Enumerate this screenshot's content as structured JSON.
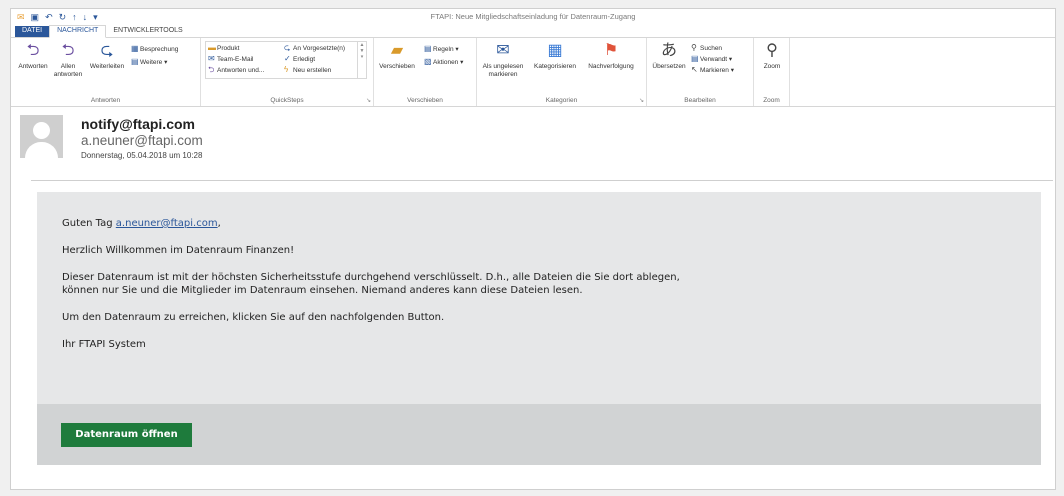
{
  "window": {
    "title": "FTAPI: Neue Mitgliedschaftseinladung für Datenraum-Zugang",
    "qat_icons": [
      "mail-icon",
      "save-icon",
      "undo-icon",
      "redo-icon",
      "up-arrow-icon",
      "down-arrow-icon",
      "customize-icon"
    ]
  },
  "tabs": [
    "DATEI",
    "NACHRICHT",
    "ENTWICKLERTOOLS"
  ],
  "ribbon": {
    "antworten": {
      "label": "Antworten",
      "reply": "Antworten",
      "reply_all": "Allen antworten",
      "forward": "Weiterleiten",
      "meeting": "Besprechung",
      "more": "Weitere"
    },
    "quicksteps": {
      "label": "QuickSteps",
      "items": [
        "Produkt",
        "Team-E-Mail",
        "Antworten und...",
        "An Vorgesetzte(n)",
        "Erledigt",
        "Neu erstellen"
      ]
    },
    "verschieben": {
      "label": "Verschieben",
      "move": "Verschieben",
      "rules": "Regeln",
      "actions": "Aktionen"
    },
    "kategorien": {
      "label": "Kategorien",
      "unread": "Als ungelesen markieren",
      "categorize": "Kategorisieren",
      "followup": "Nachverfolgung"
    },
    "bearbeiten": {
      "label": "Bearbeiten",
      "translate": "Übersetzen",
      "search": "Suchen",
      "related": "Verwandt",
      "select": "Markieren"
    },
    "zoom": {
      "label": "Zoom",
      "zoom": "Zoom"
    }
  },
  "message": {
    "from": "notify@ftapi.com",
    "to": "a.neuner@ftapi.com",
    "date": "Donnerstag, 05.04.2018 um 10:28"
  },
  "body": {
    "greeting_prefix": "Guten Tag ",
    "greeting_link": "a.neuner@ftapi.com",
    "greeting_suffix": ",",
    "welcome": "Herzlich Willkommen im Datenraum Finanzen!",
    "security_line1": "Dieser Datenraum ist mit der höchsten Sicherheitsstufe durchgehend verschlüsselt. D.h., alle Dateien die Sie dort ablegen,",
    "security_line2": "können nur Sie und die Mitglieder im Datenraum einsehen. Niemand anderes kann diese Dateien lesen.",
    "instruction": "Um den Datenraum zu erreichen, klicken Sie auf den nachfolgenden Button.",
    "signature": "Ihr FTAPI System",
    "button": "Datenraum öffnen"
  },
  "colors": {
    "accent": "#2b579a",
    "button": "#1e7b3c",
    "mail_bg": "#e6e7e8",
    "footer_bg": "#d1d3d4"
  }
}
